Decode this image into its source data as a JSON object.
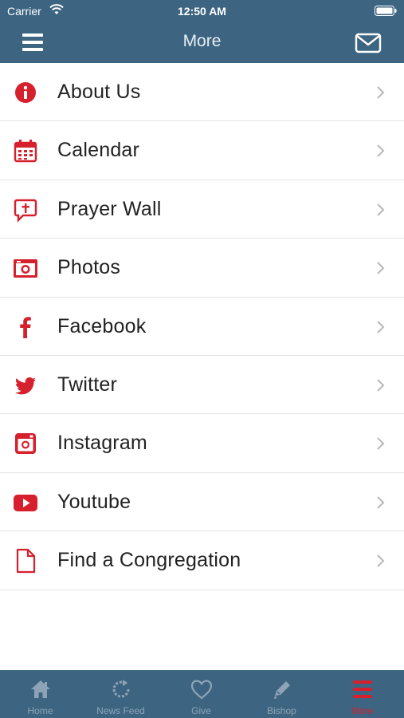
{
  "status_bar": {
    "carrier": "Carrier",
    "time": "12:50 AM"
  },
  "header": {
    "title": "More"
  },
  "menu_items": [
    {
      "label": "About Us",
      "icon": "info-icon"
    },
    {
      "label": "Calendar",
      "icon": "calendar-icon"
    },
    {
      "label": "Prayer Wall",
      "icon": "prayer-chat-icon"
    },
    {
      "label": "Photos",
      "icon": "camera-icon"
    },
    {
      "label": "Facebook",
      "icon": "facebook-icon"
    },
    {
      "label": "Twitter",
      "icon": "twitter-icon"
    },
    {
      "label": "Instagram",
      "icon": "instagram-icon"
    },
    {
      "label": "Youtube",
      "icon": "youtube-icon"
    },
    {
      "label": "Find a Congregation",
      "icon": "document-icon"
    }
  ],
  "tabs": [
    {
      "label": "Home",
      "icon": "home-icon"
    },
    {
      "label": "News Feed",
      "icon": "refresh-icon"
    },
    {
      "label": "Give",
      "icon": "heart-icon"
    },
    {
      "label": "Bishop",
      "icon": "pencil-icon"
    },
    {
      "label": "More",
      "icon": "hamburger-icon",
      "active": true
    }
  ],
  "colors": {
    "header_bg": "#3d6582",
    "accent": "#d6202e",
    "tab_inactive": "#8ea4b6"
  }
}
